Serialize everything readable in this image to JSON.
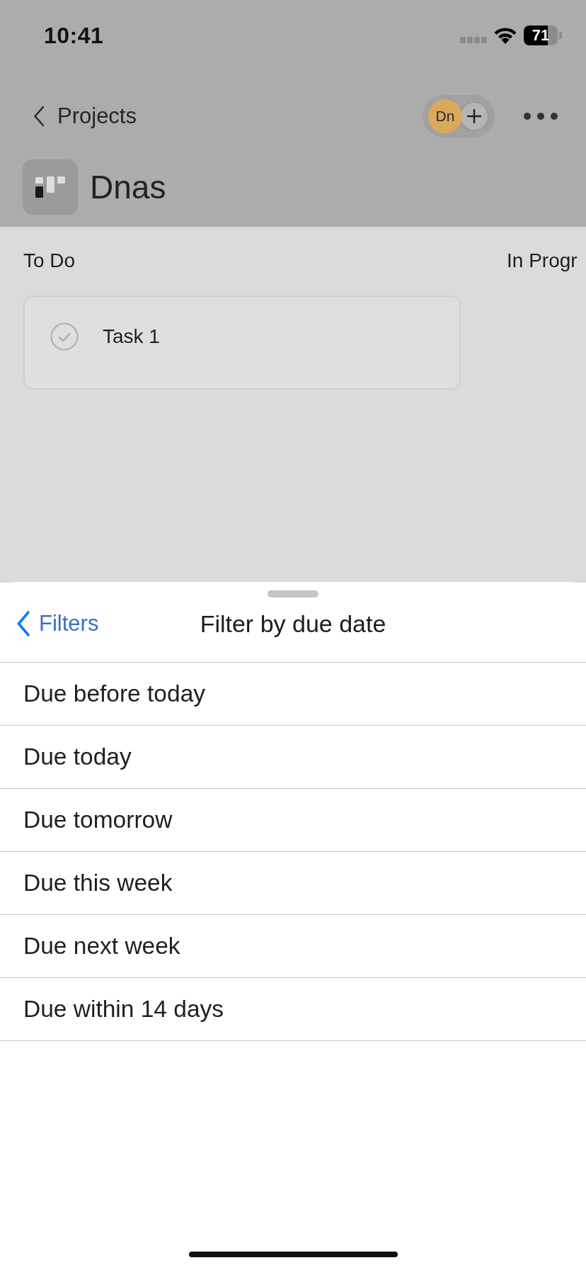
{
  "status_bar": {
    "time": "10:41",
    "battery": "71"
  },
  "header": {
    "back_label": "Projects",
    "member_initials": "Dn",
    "project_title": "Dnas"
  },
  "board": {
    "columns": [
      {
        "title": "To Do",
        "cards": [
          {
            "title": "Task 1",
            "completed": false
          }
        ]
      },
      {
        "title": "In Progr"
      }
    ]
  },
  "sheet": {
    "back_label": "Filters",
    "title": "Filter by due date",
    "options": [
      {
        "label": "Due before today",
        "selected": false
      },
      {
        "label": "Due today",
        "selected": false
      },
      {
        "label": "Due tomorrow",
        "selected": false
      },
      {
        "label": "Due this week",
        "selected": false
      },
      {
        "label": "Due next week",
        "selected": false
      },
      {
        "label": "Due within 14 days",
        "selected": false
      }
    ]
  }
}
